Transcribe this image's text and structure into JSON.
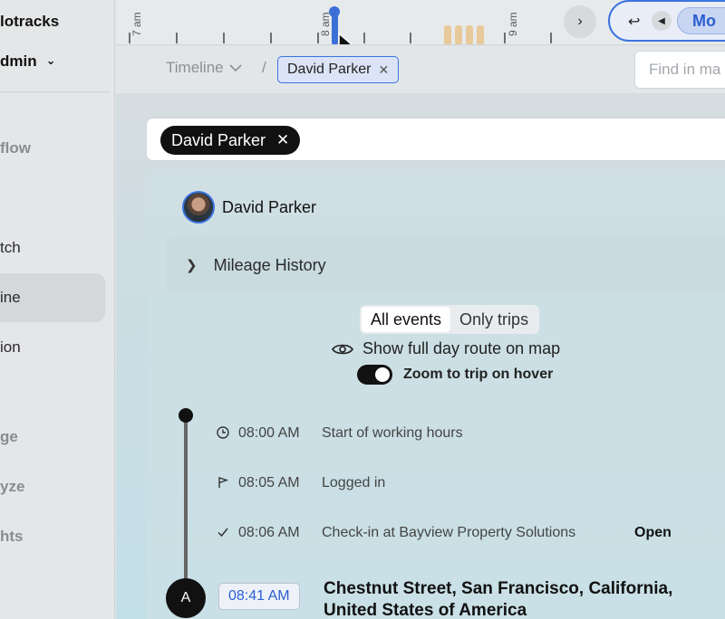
{
  "sidebar": {
    "brand": "lotracks",
    "role": "dmin",
    "items": [
      {
        "label": "flow",
        "state": "muted"
      },
      {
        "label": "tch",
        "state": "normal"
      },
      {
        "label": "ine",
        "state": "active"
      },
      {
        "label": "ion",
        "state": "normal"
      },
      {
        "label": "ge",
        "state": "muted"
      },
      {
        "label": "yze",
        "state": "muted"
      },
      {
        "label": "hts",
        "state": "muted"
      }
    ]
  },
  "timeline": {
    "hours": [
      "7 am",
      "8 am",
      "9 am"
    ],
    "mode_label": "Mo"
  },
  "breadcrumb": {
    "root": "Timeline",
    "separator": "/",
    "current": "David Parker",
    "search_placeholder": "Find in ma"
  },
  "filter": {
    "chip_label": "David Parker"
  },
  "person": {
    "name": "David Parker"
  },
  "mileage": {
    "label": "Mileage History"
  },
  "view_toggle": {
    "options": [
      "All events",
      "Only trips"
    ],
    "selected": "All events"
  },
  "route": {
    "label": "Show full day route on map"
  },
  "zoom": {
    "label": "Zoom to trip on hover",
    "enabled": true
  },
  "events": [
    {
      "icon": "clock-icon",
      "time": "08:00 AM",
      "text": "Start of working hours"
    },
    {
      "icon": "flag-icon",
      "time": "08:05 AM",
      "text": "Logged in"
    },
    {
      "icon": "check-icon",
      "time": "08:06 AM",
      "text": "Check-in at Bayview Property Solutions",
      "action": "Open"
    }
  ],
  "stop": {
    "marker": "A",
    "time": "08:41 AM",
    "address": "Chestnut Street, San Francisco, California, United States of America"
  },
  "colors": {
    "accent": "#3b73e0",
    "activity_block": "#e8c99b"
  }
}
